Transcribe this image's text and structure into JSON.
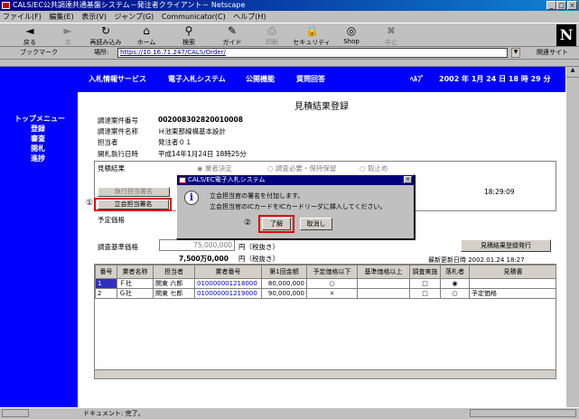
{
  "window": {
    "title": "CALS/EC公共調達共通基盤システム－発注者クライアント－ Netscape",
    "min": "_",
    "max": "□",
    "close": "×"
  },
  "menu": [
    "ファイル(F)",
    "編集(E)",
    "表示(V)",
    "ジャンプ(G)",
    "Communicator(C)",
    "ヘルプ(H)"
  ],
  "toolbar": [
    {
      "label": "戻る",
      "icon": "◄",
      "disabled": false
    },
    {
      "label": "次",
      "icon": "►",
      "disabled": true
    },
    {
      "label": "再読み込み",
      "icon": "↻",
      "disabled": false
    },
    {
      "label": "ホーム",
      "icon": "⌂",
      "disabled": false
    },
    {
      "label": "検索",
      "icon": "⚲",
      "disabled": false
    },
    {
      "label": "ガイド",
      "icon": "✎",
      "disabled": false
    },
    {
      "label": "印刷",
      "icon": "⎙",
      "disabled": true
    },
    {
      "label": "セキュリティ",
      "icon": "🔒",
      "disabled": false
    },
    {
      "label": "Shop",
      "icon": "◎",
      "disabled": false
    },
    {
      "label": "中止",
      "icon": "✖",
      "disabled": true
    }
  ],
  "location": {
    "bookmark": "ブックマーク",
    "label": "場所:",
    "url": "https://10.16.71.247/CALS/Order/",
    "related": "関連サイト"
  },
  "sidebar": {
    "title": "トップメニュー",
    "items": [
      "登録",
      "審査",
      "開札",
      "進捗"
    ]
  },
  "topnav": {
    "items": [
      "入札情報サービス",
      "電子入札システム",
      "公開機能",
      "質問回答"
    ],
    "help": "ﾍﾙﾌﾟ",
    "date": "2002 年 1月 24 日 18 時 29 分"
  },
  "page": {
    "title": "見積結果登録"
  },
  "info": [
    {
      "label": "調達案件番号",
      "value": "002008302820010008"
    },
    {
      "label": "調達案件名称",
      "value": "Ｈ池東那線構基本設計"
    },
    {
      "label": "担当者",
      "value": "発注者０１"
    },
    {
      "label": "開札執行日時",
      "value": "平成14年1月24日 18時25分"
    }
  ],
  "result": {
    "label": "見積結果",
    "options": [
      "業者決定",
      "調査必要・保持保留",
      "取止め"
    ],
    "selected": 0
  },
  "buttons": {
    "officer_sign": "執行担当署名",
    "witness_sign": "立会担当署名",
    "issue": "見積結果登録発行"
  },
  "time_value": "18:29:09",
  "expected_price_label": "予定価格",
  "base_price": {
    "label": "調査基準価格",
    "input": "75,000,000",
    "unit": "円（税抜き）",
    "value2": "7,500万0,000",
    "unit2": "円（税抜き）"
  },
  "updated": "最新更新日時 2002.01.24 18:27",
  "annotations": {
    "one": "①",
    "two": "②"
  },
  "table": {
    "headers": [
      "番号",
      "業者名称",
      "担当者",
      "業者番号",
      "第1回金額",
      "予定価格以下",
      "基準価格以上",
      "調査実施",
      "落札者",
      "見積書"
    ],
    "rows": [
      {
        "no": "1",
        "name": "Ｆ社",
        "person": "関東 六郎",
        "num": "010000001218000",
        "amount": "80,000,000",
        "under": "○",
        "over": "",
        "check": "□",
        "winner": "◉",
        "doc": ""
      },
      {
        "no": "2",
        "name": "Ｇ社",
        "person": "関東 七郎",
        "num": "010000001219000",
        "amount": "90,000,000",
        "under": "×",
        "over": "",
        "check": "□",
        "winner": "○",
        "doc": "予定価格"
      }
    ]
  },
  "dialog": {
    "title": "CALS/EC電子入札システム",
    "line1": "立会担当官の署名を付加します。",
    "line2": "立会担当官のICカードをICカードリーダに挿入してください。",
    "ok": "了解",
    "cancel": "取消し"
  },
  "status": {
    "text": "ドキュメント: 完了。"
  }
}
